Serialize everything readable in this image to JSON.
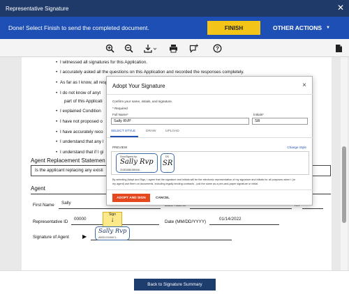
{
  "window": {
    "title": "Representative Signature"
  },
  "banner": {
    "message": "Done! Select Finish to send the completed document.",
    "finish_label": "FINISH",
    "other_actions_label": "OTHER ACTIONS"
  },
  "document": {
    "bullets": [
      "I witnessed all signatures for this Application.",
      "I accurately asked all the questions on this Application and recorded the responses completely.",
      "As far as I know, all responses are true.",
      "I do not know of anyt",
      "part of this Applicati",
      "I explained Condition",
      "I have not proposed o",
      "I have accurately reco",
      "I understand that any l",
      "I understand that if I gi"
    ],
    "replacement_heading": "Agent Replacement Statemen",
    "replacement_question": "Is the applicant replacing any existi",
    "agent_heading": "Agent",
    "fields": {
      "first_name_label": "First Name",
      "first_name_value": "Sally",
      "last_name_label": "Last Name",
      "mi_label": "MI",
      "rep_id_label": "Representative ID",
      "rep_id_value": "00000",
      "date_label": "Date (MM/DD/YYYY)",
      "date_value": "01/14/2022",
      "signature_label": "Signature of Agent"
    },
    "sign_tab_label": "Sign",
    "signed_name": "Sally Rvp",
    "signed_id": "AB3D123456C1..."
  },
  "modal": {
    "title": "Adopt Your Signature",
    "instructions": "Confirm your name, initials, and signature.",
    "required_note": "* Required",
    "full_name_label": "Full Name*",
    "full_name_value": "Sally RVP",
    "initials_label": "Initials*",
    "initials_value": "SR",
    "tabs": [
      "SELECT STYLE",
      "DRAW",
      "UPLOAD"
    ],
    "preview_label": "PREVIEW",
    "change_style": "Change Style",
    "docusigned_by": "DocuSigned by:",
    "signature_preview": "Sally Rvp",
    "signature_id": "2108348B1569446...",
    "initials_header": "DS",
    "initials_preview": "SR",
    "legal_line1": "By selecting Adopt and Sign, I agree that the signature and initials will be the electronic representation of my signature and initials for all purposes when I (or",
    "legal_line2": "my agent) use them on documents, including legally binding contracts - just the same as a pen-and-paper signature or initial.",
    "adopt_label": "ADOPT AND SIGN",
    "cancel_label": "CANCEL"
  },
  "footer": {
    "back_label": "Back to Signature Summary"
  },
  "colors": {
    "header": "#1f3a68",
    "banner": "#1e4fb4",
    "finish": "#f4c419",
    "adopt": "#e5471e",
    "footer_button": "#1e3d6f",
    "sign_tab": "#fde98a"
  },
  "icons": [
    "zoom-in-icon",
    "zoom-out-icon",
    "download-icon",
    "print-icon",
    "add-comment-icon",
    "help-icon",
    "document-icon"
  ]
}
